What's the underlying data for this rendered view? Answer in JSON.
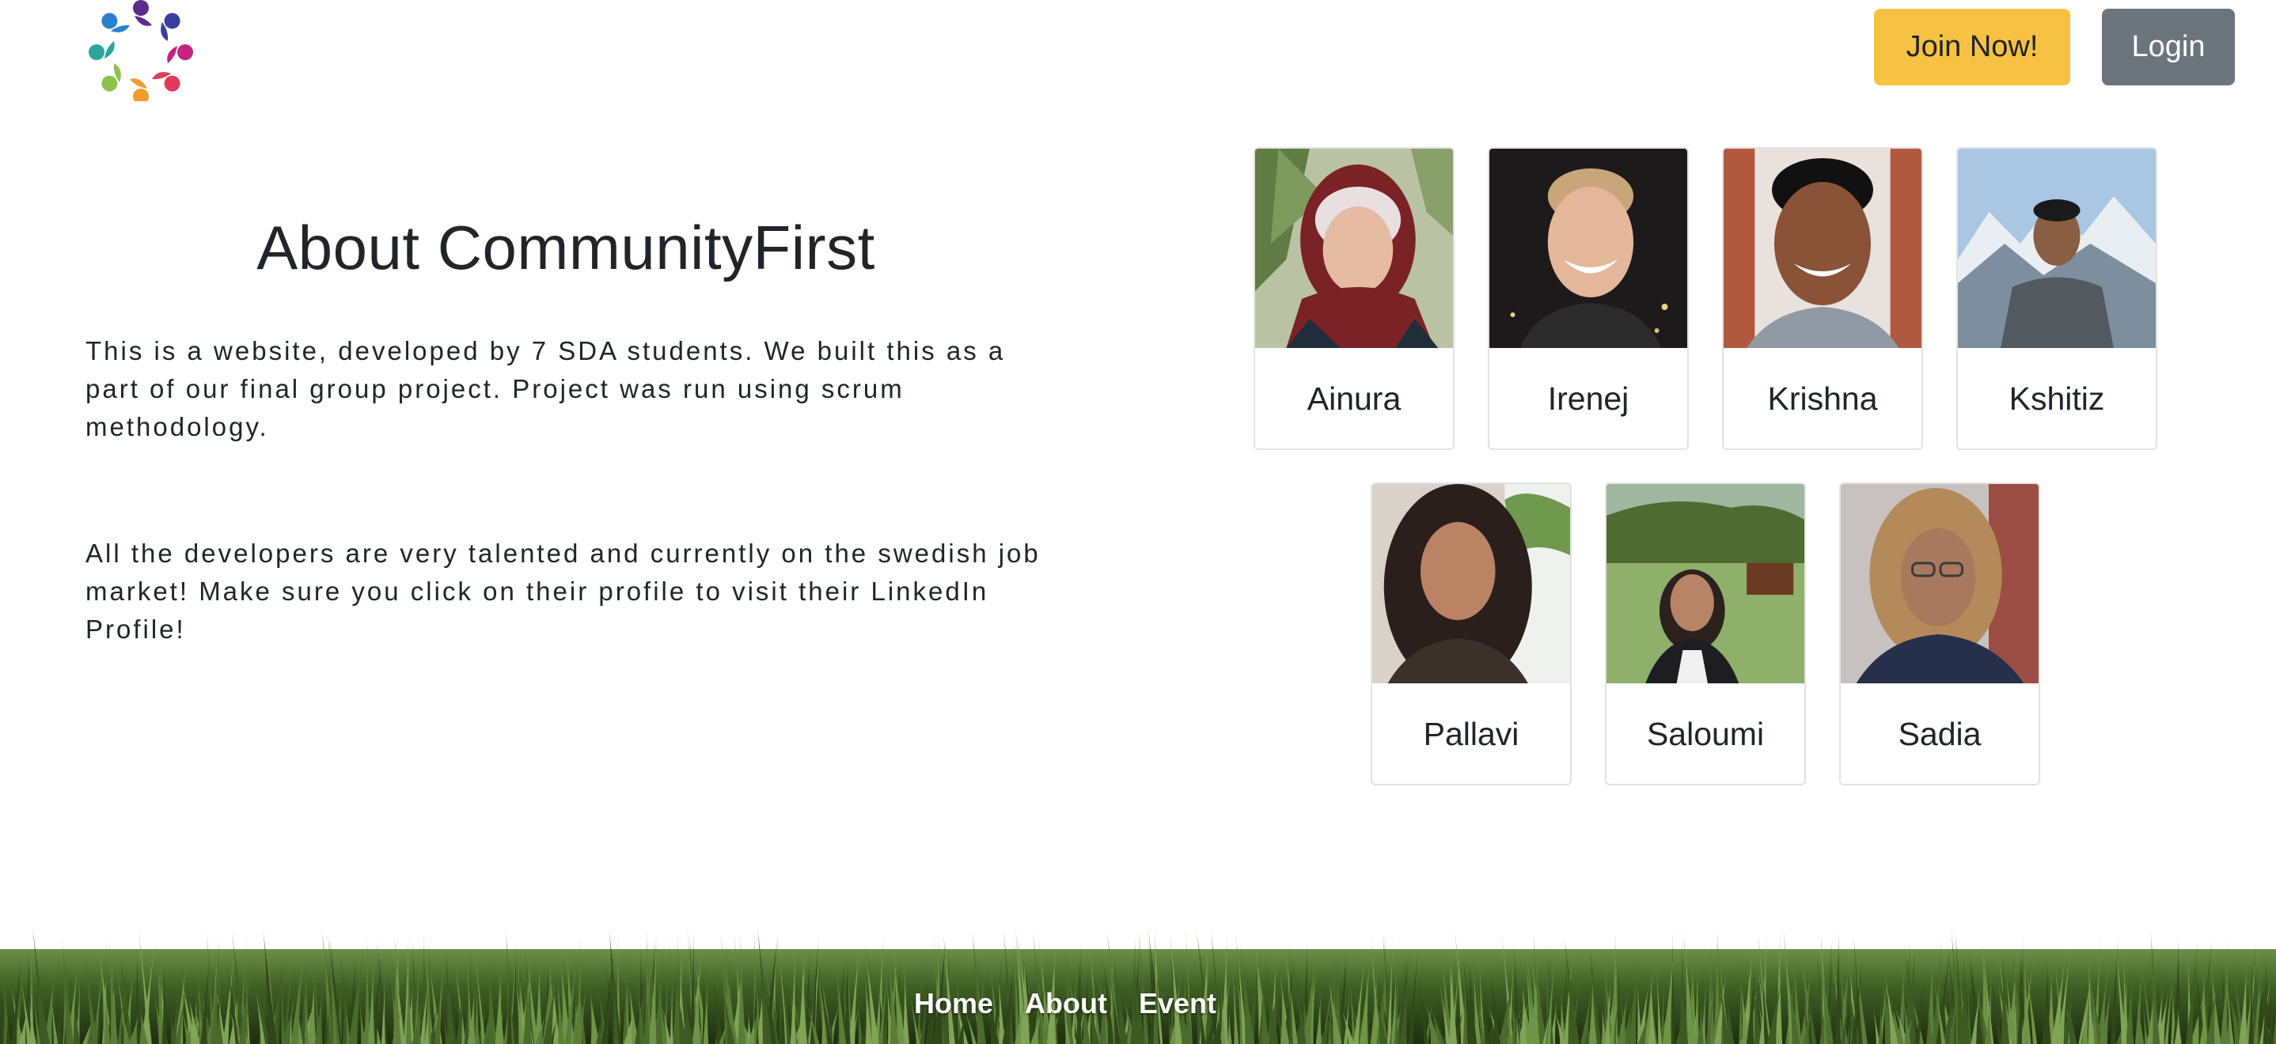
{
  "header": {
    "logo_name": "community-circle-logo",
    "join_label": "Join Now!",
    "login_label": "Login",
    "colors": {
      "join": "#f7c244",
      "login": "#6c757d"
    }
  },
  "about": {
    "title": "About CommunityFirst",
    "paragraph1": "This is a website, developed by 7 SDA students. We built this as a part of our final group project. Project was run using scrum methodology.",
    "paragraph2": "All the developers are very talented and currently on the swedish job market! Make sure you click on their profile to visit their LinkedIn Profile!"
  },
  "team": [
    {
      "name": "Ainura"
    },
    {
      "name": "Irenej"
    },
    {
      "name": "Krishna"
    },
    {
      "name": "Kshitiz"
    },
    {
      "name": "Pallavi"
    },
    {
      "name": "Saloumi"
    },
    {
      "name": "Sadia"
    }
  ],
  "footer": {
    "nav": [
      "Home",
      "About",
      "Event"
    ],
    "background": "grass"
  }
}
